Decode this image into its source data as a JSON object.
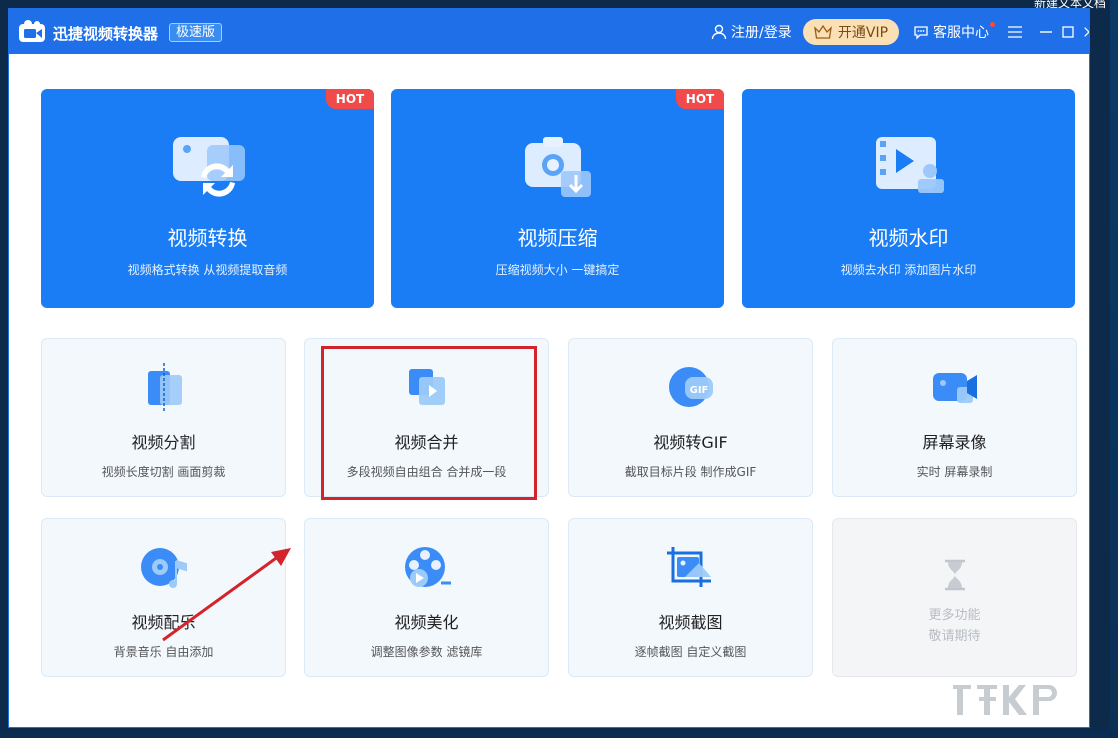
{
  "desktop": {
    "corner_text": "新建文本文档"
  },
  "titlebar": {
    "app_title": "迅捷视频转换器",
    "app_badge": "极速版",
    "login_label": "注册/登录",
    "vip_label": "开通VIP",
    "support_label": "客服中心"
  },
  "big_cards": [
    {
      "title": "视频转换",
      "subtitle": "视频格式转换 从视频提取音频",
      "hot": "HOT"
    },
    {
      "title": "视频压缩",
      "subtitle": "压缩视频大小 一键搞定",
      "hot": "HOT"
    },
    {
      "title": "视频水印",
      "subtitle": "视频去水印 添加图片水印"
    }
  ],
  "small_cards": [
    {
      "title": "视频分割",
      "subtitle": "视频长度切割 画面剪裁"
    },
    {
      "title": "视频合并",
      "subtitle": "多段视频自由组合 合并成一段"
    },
    {
      "title": "视频转GIF",
      "subtitle": "截取目标片段 制作成GIF"
    },
    {
      "title": "屏幕录像",
      "subtitle": "实时 屏幕录制"
    },
    {
      "title": "视频配乐",
      "subtitle": "背景音乐 自由添加"
    },
    {
      "title": "视频美化",
      "subtitle": "调整图像参数 滤镜库"
    },
    {
      "title": "视频截图",
      "subtitle": "逐帧截图 自定义截图"
    },
    {
      "title": "更多功能",
      "subtitle": "敬请期待"
    }
  ],
  "colors": {
    "titlebar": "#1e6fe8",
    "card_blue": "#1a7df5",
    "hot": "#f04a4a",
    "highlight": "#d2242a",
    "vip_bg": "#fbe0b6"
  }
}
